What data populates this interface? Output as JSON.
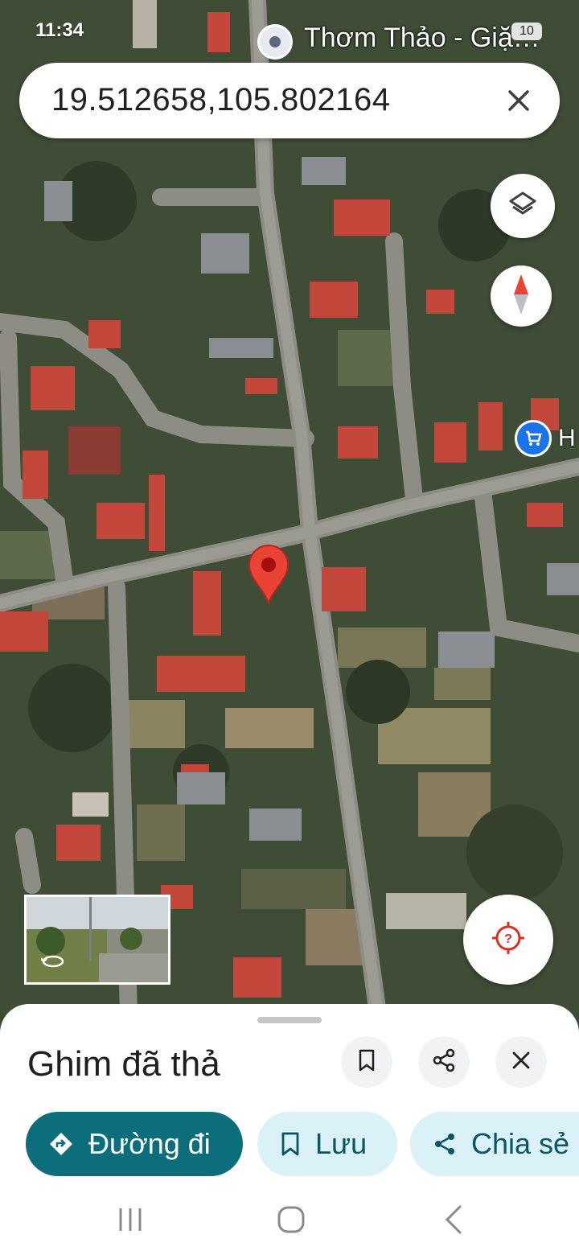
{
  "status_bar": {
    "time": "11:34",
    "battery": "10"
  },
  "map": {
    "top_place_label": "Thơm Thảo - Giặ…",
    "shop_label": "H",
    "colors": {
      "pin": "#ea4335",
      "shop": "#1a73e8",
      "target": "#d93025"
    }
  },
  "search": {
    "query": "19.512658,105.802164",
    "clear_icon": "close-icon"
  },
  "sheet": {
    "title": "Ghim đã thả",
    "actions": [
      "save-icon",
      "share-icon",
      "close-icon"
    ],
    "chips": [
      {
        "label": "Đường đi",
        "icon": "directions-icon"
      },
      {
        "label": "Lưu",
        "icon": "bookmark-icon"
      },
      {
        "label": "Chia sẻ",
        "icon": "share-icon"
      }
    ]
  },
  "colors": {
    "primary": "#0b6e7a",
    "secondary_chip": "#d9f1f7",
    "sheet_bg": "#ffffff"
  }
}
